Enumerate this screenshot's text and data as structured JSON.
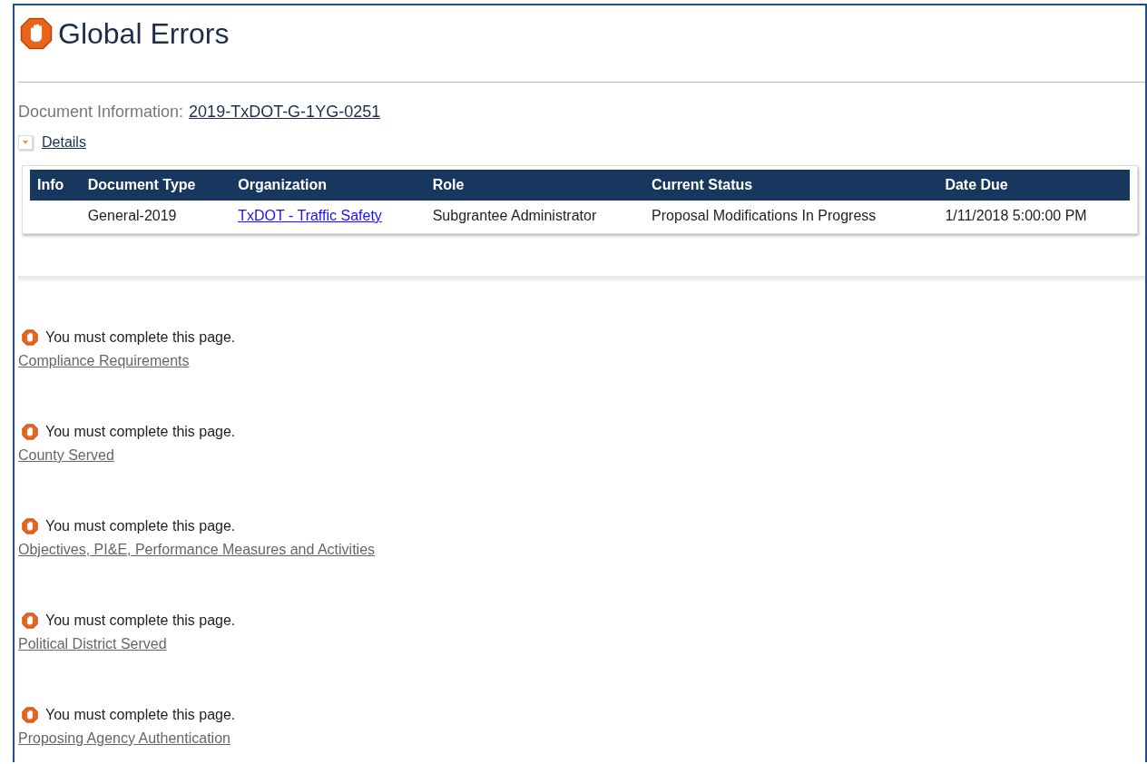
{
  "page": {
    "title": "Global Errors"
  },
  "document_information": {
    "label": "Document Information:",
    "number": "2019-TxDOT-G-1YG-0251"
  },
  "details": {
    "label": "Details",
    "expanded": true
  },
  "table": {
    "columns": [
      "Info",
      "Document Type",
      "Organization",
      "Role",
      "Current Status",
      "Date Due"
    ],
    "rows": [
      {
        "cells": [
          {
            "kind": "empty"
          },
          {
            "kind": "text",
            "text": "General-2019"
          },
          {
            "kind": "link",
            "text": "TxDOT - Traffic Safety"
          },
          {
            "kind": "text",
            "text": "Subgrantee Administrator"
          },
          {
            "kind": "text",
            "text": "Proposal Modifications In Progress"
          },
          {
            "kind": "text",
            "text": "1/11/2018 5:00:00 PM"
          }
        ]
      }
    ]
  },
  "errors": [
    {
      "message": "You must complete this page.",
      "page": "Compliance Requirements"
    },
    {
      "message": "You must complete this page.",
      "page": "County Served"
    },
    {
      "message": "You must complete this page.",
      "page": "Objectives, PI&E, Performance Measures and Activities"
    },
    {
      "message": "You must complete this page.",
      "page": "Political District Served"
    },
    {
      "message": "You must complete this page.",
      "page": "Proposing Agency Authentication"
    }
  ]
}
